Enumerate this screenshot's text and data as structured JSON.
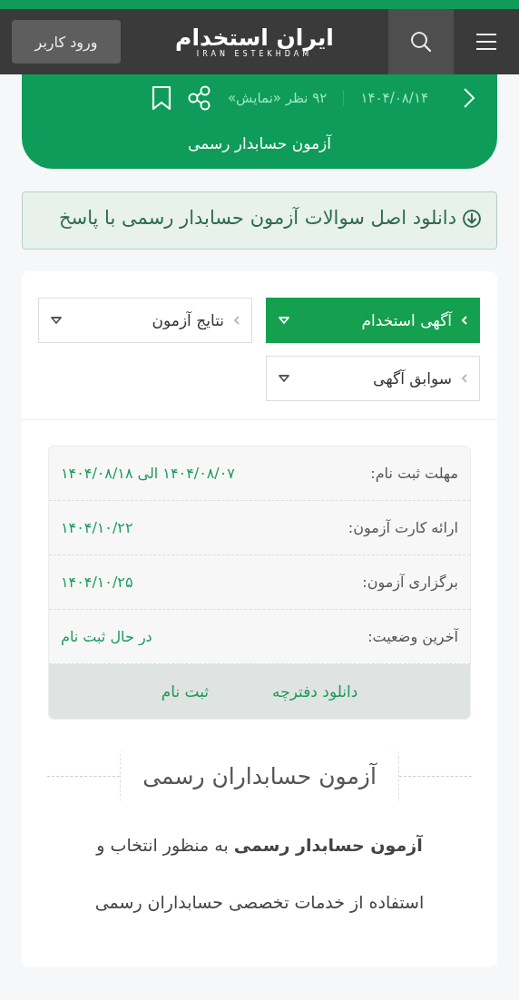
{
  "header": {
    "login_button": "ورود کاربر",
    "logo": {
      "text": "ایران استخدام",
      "subtitle": "IRAN ESTEKHDAM"
    }
  },
  "post_banner": {
    "date": "۱۴۰۴/۰۸/۱۴",
    "views": "۹۲ نظر «نمایش»",
    "title": "آزمون حسابدار رسمی"
  },
  "download_notice": "دانلود اصل سوالات آزمون حسابدار رسمی با پاسخ",
  "dropdowns": [
    {
      "label": "آگهی استخدام",
      "selected": true
    },
    {
      "label": "نتایج آزمون",
      "selected": false
    },
    {
      "label": "سوابق آگهی",
      "selected": false
    }
  ],
  "info_table": {
    "rows": [
      {
        "label": "مهلت ثبت نام:",
        "value": "۱۴۰۴/۰۸/۰۷ الی ۱۴۰۴/۰۸/۱۸"
      },
      {
        "label": "ارائه کارت آزمون:",
        "value": "۱۴۰۴/۱۰/۲۲"
      },
      {
        "label": "برگزاری آزمون:",
        "value": "۱۴۰۴/۱۰/۲۵"
      },
      {
        "label": "آخرین وضعیت:",
        "value": "در حال ثبت نام"
      }
    ],
    "links": [
      "دانلود دفترچه",
      "ثبت نام"
    ]
  },
  "section_title": "آزمون حسابداران رسمی",
  "paragraph": "**آزمون حسابدار رسمی** به منظور انتخاب و استفاده از خدمات تخصصی حسابداران رسمی"
}
